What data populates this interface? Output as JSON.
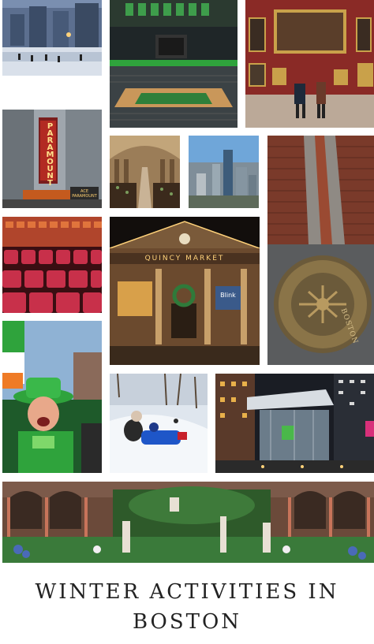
{
  "title": {
    "line1": "WINTER ACTIVITIES IN",
    "line2": "BOSTON"
  },
  "signs": {
    "paramount": "PARAMOUNT",
    "paramount_small": "ACE PARAMOUNT",
    "quincy_market": "QUINCY MARKET",
    "blink": "Blink",
    "boston_seal": "BOSTON"
  },
  "colors": {
    "accent_green": "#2fa33c",
    "brick": "#7a3a2a",
    "museum_red": "#8a2a26",
    "sky": "#6fa6d9"
  }
}
